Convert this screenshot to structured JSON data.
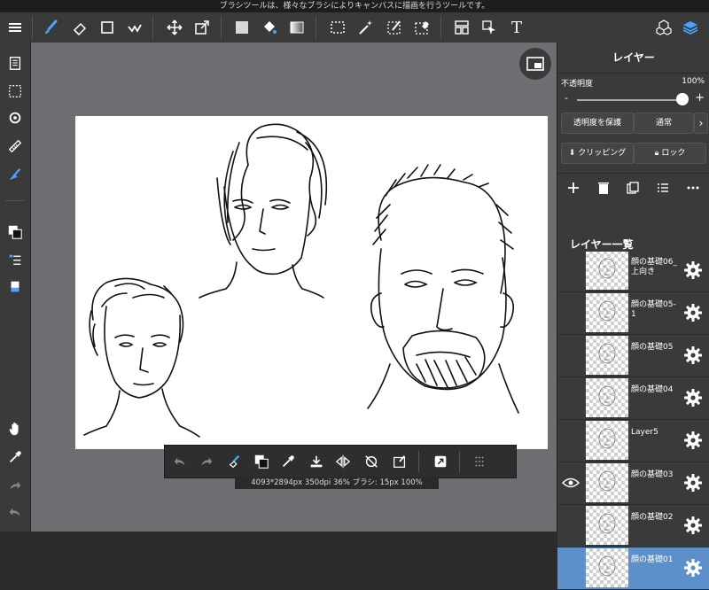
{
  "status_hint": "ブラシツールは、様々なブラシによりキャンバスに描画を行うツールです。",
  "top_toolbar": {
    "icons": [
      "menu-icon",
      "brush-icon",
      "eraser-icon",
      "square-icon",
      "smudge-icon",
      "move-icon",
      "transform-icon",
      "fill-color-icon",
      "bucket-icon",
      "gradient-icon",
      "select-icon",
      "magic-wand-icon",
      "select-pen-icon",
      "select-eraser-icon",
      "layout-icon",
      "pointer-icon",
      "text-icon",
      "3d-icon",
      "layers-icon"
    ],
    "text_tool_label": "T"
  },
  "left_toolbar": {
    "icons": [
      "pages-icon",
      "selection-icon",
      "snap-icon",
      "ruler-icon",
      "fill-triangle-icon",
      "color-icon",
      "brush-list-icon",
      "eraser-size-icon",
      "hand-icon",
      "eyedropper-icon",
      "redo-icon",
      "undo-icon"
    ]
  },
  "canvas_info": "4093*2894px 350dpi 36% ブラシ: 15px 100%",
  "bottom_toolbar": {
    "icons": [
      "undo-icon",
      "redo-icon",
      "brush-eraser-icon",
      "color-swap-icon",
      "eyedropper-icon",
      "save-icon",
      "flip-icon",
      "rotate-reset-icon",
      "selection-icon",
      "fullscreen-icon",
      "grid-icon"
    ]
  },
  "layer_panel": {
    "title": "レイヤー",
    "opacity_label": "不透明度",
    "opacity_value": "100%",
    "opacity_fraction": 1.0,
    "slider_minus": "-",
    "slider_plus": "+",
    "protect_alpha_label": "透明度を保護",
    "blend_mode_label": "通常",
    "clipping_label": "クリッピング",
    "lock_label": "ロック",
    "list_title": "レイヤー一覧",
    "accent_color": "#5d8fc9",
    "layers": [
      {
        "name": "顔の基礎06_上向き",
        "visible": false,
        "selected": false
      },
      {
        "name": "顔の基礎05-1",
        "visible": false,
        "selected": false
      },
      {
        "name": "顔の基礎05",
        "visible": false,
        "selected": false
      },
      {
        "name": "顔の基礎04",
        "visible": false,
        "selected": false
      },
      {
        "name": "Layer5",
        "visible": false,
        "selected": false
      },
      {
        "name": "顔の基礎03",
        "visible": true,
        "selected": false
      },
      {
        "name": "顔の基礎02",
        "visible": false,
        "selected": false
      },
      {
        "name": "顔の基礎01",
        "visible": false,
        "selected": true
      }
    ]
  }
}
